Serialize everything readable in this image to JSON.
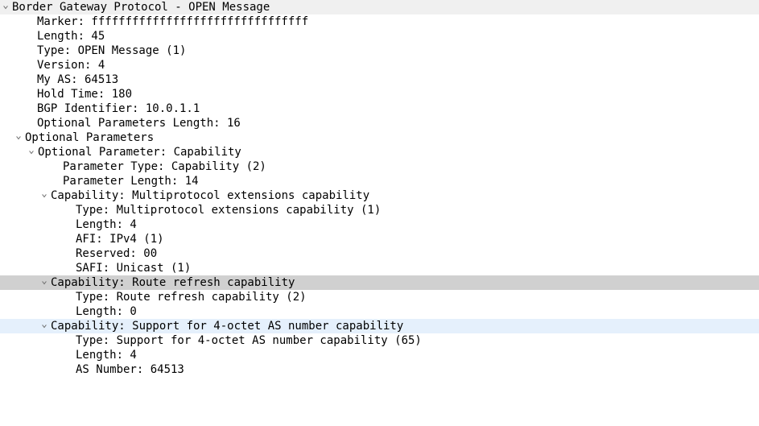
{
  "header": {
    "label": "Border Gateway Protocol - OPEN Message"
  },
  "fields": {
    "marker": {
      "name": "Marker",
      "value": "ffffffffffffffffffffffffffffffff"
    },
    "length": {
      "name": "Length",
      "value": "45"
    },
    "type": {
      "name": "Type",
      "value": "OPEN Message (1)"
    },
    "version": {
      "name": "Version",
      "value": "4"
    },
    "my_as": {
      "name": "My AS",
      "value": "64513"
    },
    "hold_time": {
      "name": "Hold Time",
      "value": "180"
    },
    "bgp_id": {
      "name": "BGP Identifier",
      "value": "10.0.1.1"
    },
    "opt_len": {
      "name": "Optional Parameters Length",
      "value": "16"
    }
  },
  "opt_params": {
    "label": "Optional Parameters",
    "param": {
      "label": "Optional Parameter: Capability",
      "ptype": {
        "name": "Parameter Type",
        "value": "Capability (2)"
      },
      "plen": {
        "name": "Parameter Length",
        "value": "14"
      },
      "caps": [
        {
          "label": "Capability: Multiprotocol extensions capability",
          "rows": [
            {
              "name": "Type",
              "value": "Multiprotocol extensions capability (1)"
            },
            {
              "name": "Length",
              "value": "4"
            },
            {
              "name": "AFI",
              "value": "IPv4 (1)"
            },
            {
              "name": "Reserved",
              "value": "00"
            },
            {
              "name": "SAFI",
              "value": "Unicast (1)"
            }
          ],
          "highlight": "none"
        },
        {
          "label": "Capability: Route refresh capability",
          "rows": [
            {
              "name": "Type",
              "value": "Route refresh capability (2)"
            },
            {
              "name": "Length",
              "value": "0"
            }
          ],
          "highlight": "grey"
        },
        {
          "label": "Capability: Support for 4-octet AS number capability",
          "rows": [
            {
              "name": "Type",
              "value": "Support for 4-octet AS number capability (65)"
            },
            {
              "name": "Length",
              "value": "4"
            },
            {
              "name": "AS Number",
              "value": "64513"
            }
          ],
          "highlight": "blue"
        }
      ]
    }
  }
}
